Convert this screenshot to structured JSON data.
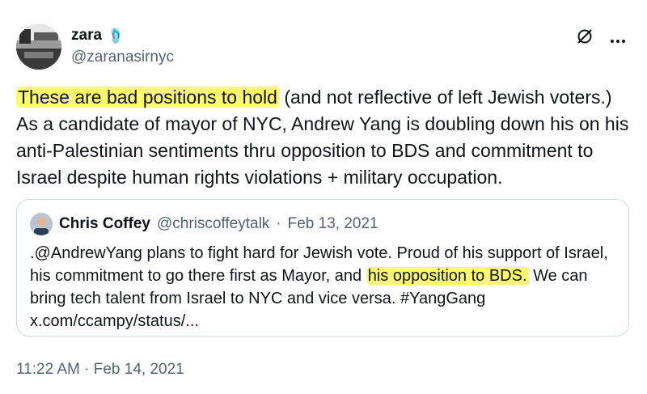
{
  "author": {
    "name": "zara",
    "handle": "@zaranasirnyc",
    "emoji": "🩴"
  },
  "icons": {
    "grok": "grok-slash-icon",
    "more": "more-options-icon"
  },
  "tweet": {
    "highlighted_text": "These are bad positions to hold",
    "rest_text": " (and not reflective of left Jewish voters.) As a candidate of mayor of NYC, Andrew Yang is doubling down his on his anti-Palestinian sentiments thru opposition to BDS and commitment to Israel despite human rights violations + military occupation."
  },
  "quote": {
    "name": "Chris Coffey",
    "handle": "@chriscoffeytalk",
    "separator": "·",
    "date": "Feb 13, 2021",
    "text_before": ".@AndrewYang plans to fight hard for Jewish vote. Proud of his support of Israel, his commitment to go there first as Mayor, and ",
    "highlighted_text": "his opposition to BDS.",
    "text_after": " We can bring tech talent from Israel to NYC and vice versa. #YangGang x.com/ccampy/status/..."
  },
  "timestamp": "11:22 AM · Feb 14, 2021",
  "colors": {
    "highlight": "#fdfa6c",
    "text": "#0f1419",
    "secondary": "#536471",
    "border": "#cfd9de"
  }
}
